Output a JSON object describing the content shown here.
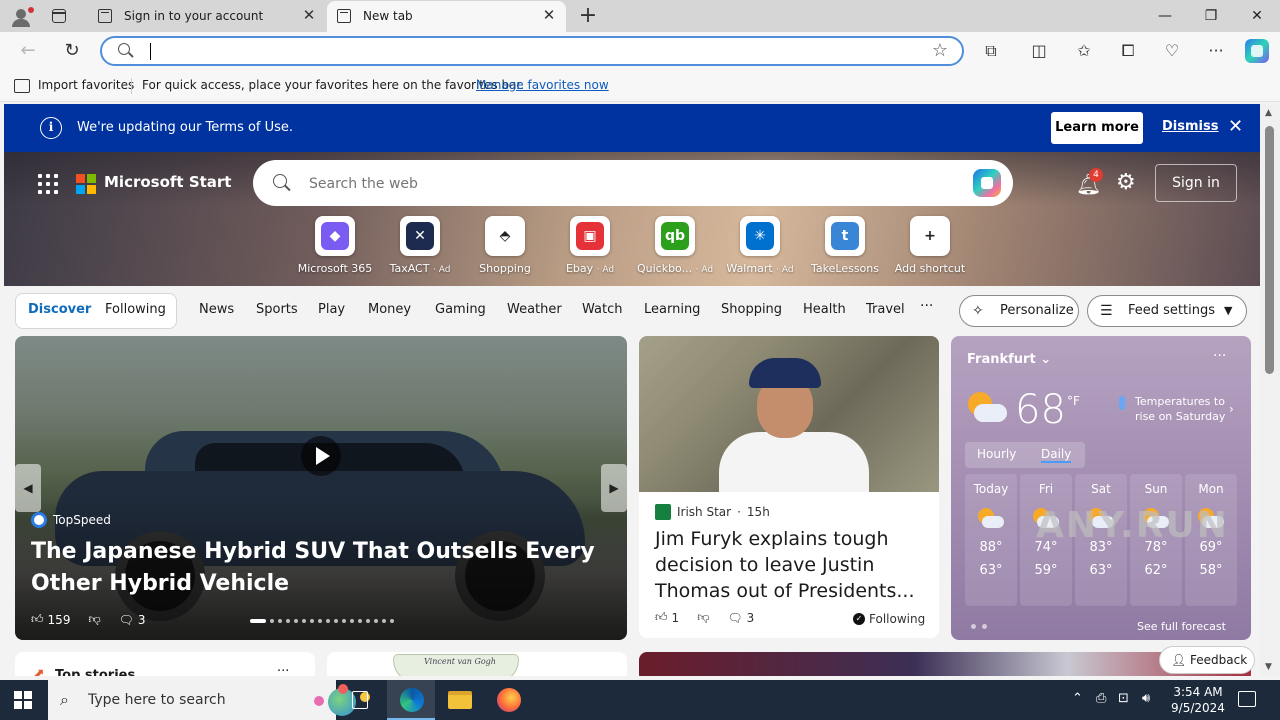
{
  "browser": {
    "tabs": [
      {
        "title": "Sign in to your account",
        "active": false
      },
      {
        "title": "New tab",
        "active": true
      }
    ],
    "address": {
      "value": "",
      "placeholder": ""
    },
    "favorites_bar": {
      "import_label": "Import favorites",
      "message": "For quick access, place your favorites here on the favorites bar.",
      "manage_link": "Manage favorites now"
    }
  },
  "banner": {
    "text": "We're updating our Terms of Use.",
    "learn_more": "Learn more",
    "dismiss": "Dismiss"
  },
  "hero": {
    "brand": "Microsoft Start",
    "search_placeholder": "Search the web",
    "notification_count": "4",
    "sign_in": "Sign in",
    "shortcuts": [
      {
        "label": "Microsoft 365",
        "ad": "",
        "icon": "microsoft-365-icon",
        "color": "#7b5cf2",
        "glyph": "◆"
      },
      {
        "label": "TaxACT",
        "ad": "· Ad",
        "icon": "taxact-icon",
        "color": "#1b2a4e",
        "glyph": "✕"
      },
      {
        "label": "Shopping",
        "ad": "",
        "icon": "tag-icon",
        "color": "#ffffff",
        "glyph": "⬘"
      },
      {
        "label": "Ebay",
        "ad": "· Ad",
        "icon": "ebay-icon",
        "color": "#e53238",
        "glyph": "▣"
      },
      {
        "label": "Quickbo...",
        "ad": "· Ad",
        "icon": "quickbooks-icon",
        "color": "#2ca01c",
        "glyph": "qb"
      },
      {
        "label": "Walmart",
        "ad": "· Ad",
        "icon": "walmart-icon",
        "color": "#0071ce",
        "glyph": "✳"
      },
      {
        "label": "TakeLessons",
        "ad": "",
        "icon": "takelessons-icon",
        "color": "#3a86d6",
        "glyph": "t"
      },
      {
        "label": "Add shortcut",
        "ad": "",
        "icon": "plus-icon",
        "color": "#ffffff",
        "glyph": "+"
      }
    ]
  },
  "feed_nav": {
    "pills": [
      "Discover",
      "Following"
    ],
    "links": [
      "News",
      "Sports",
      "Play",
      "Money",
      "Gaming",
      "Weather",
      "Watch",
      "Learning",
      "Shopping",
      "Health",
      "Travel"
    ],
    "more": "···",
    "personalize": "Personalize",
    "feed_settings": "Feed settings"
  },
  "main_story": {
    "source": "TopSpeed",
    "headline": "The Japanese Hybrid SUV That Outsells Every Other Hybrid Vehicle",
    "likes": "159",
    "comments": "3"
  },
  "news_story": {
    "source": "Irish Star",
    "age": "15h",
    "headline": "Jim Furyk explains tough decision to leave Justin Thomas out of Presidents...",
    "likes": "1",
    "comments": "3",
    "following": "Following"
  },
  "weather": {
    "city": "Frankfurt",
    "temp": "68",
    "unit": "°F",
    "note": "Temperatures to rise on Saturday",
    "tabs": [
      "Hourly",
      "Daily"
    ],
    "forecast": [
      {
        "day": "Today",
        "hi": "88°",
        "lo": "63°"
      },
      {
        "day": "Fri",
        "hi": "74°",
        "lo": "59°"
      },
      {
        "day": "Sat",
        "hi": "83°",
        "lo": "63°"
      },
      {
        "day": "Sun",
        "hi": "78°",
        "lo": "62°"
      },
      {
        "day": "Mon",
        "hi": "69°",
        "lo": "58°"
      }
    ],
    "full_forecast": "See full forecast"
  },
  "lower": {
    "top_stories": "Top stories",
    "mug_text": "Vincent van Gogh",
    "feedback": "Feedback",
    "watermark": "ANY.RUN"
  },
  "taskbar": {
    "search_placeholder": "Type here to search",
    "time": "3:54 AM",
    "date": "9/5/2024"
  }
}
